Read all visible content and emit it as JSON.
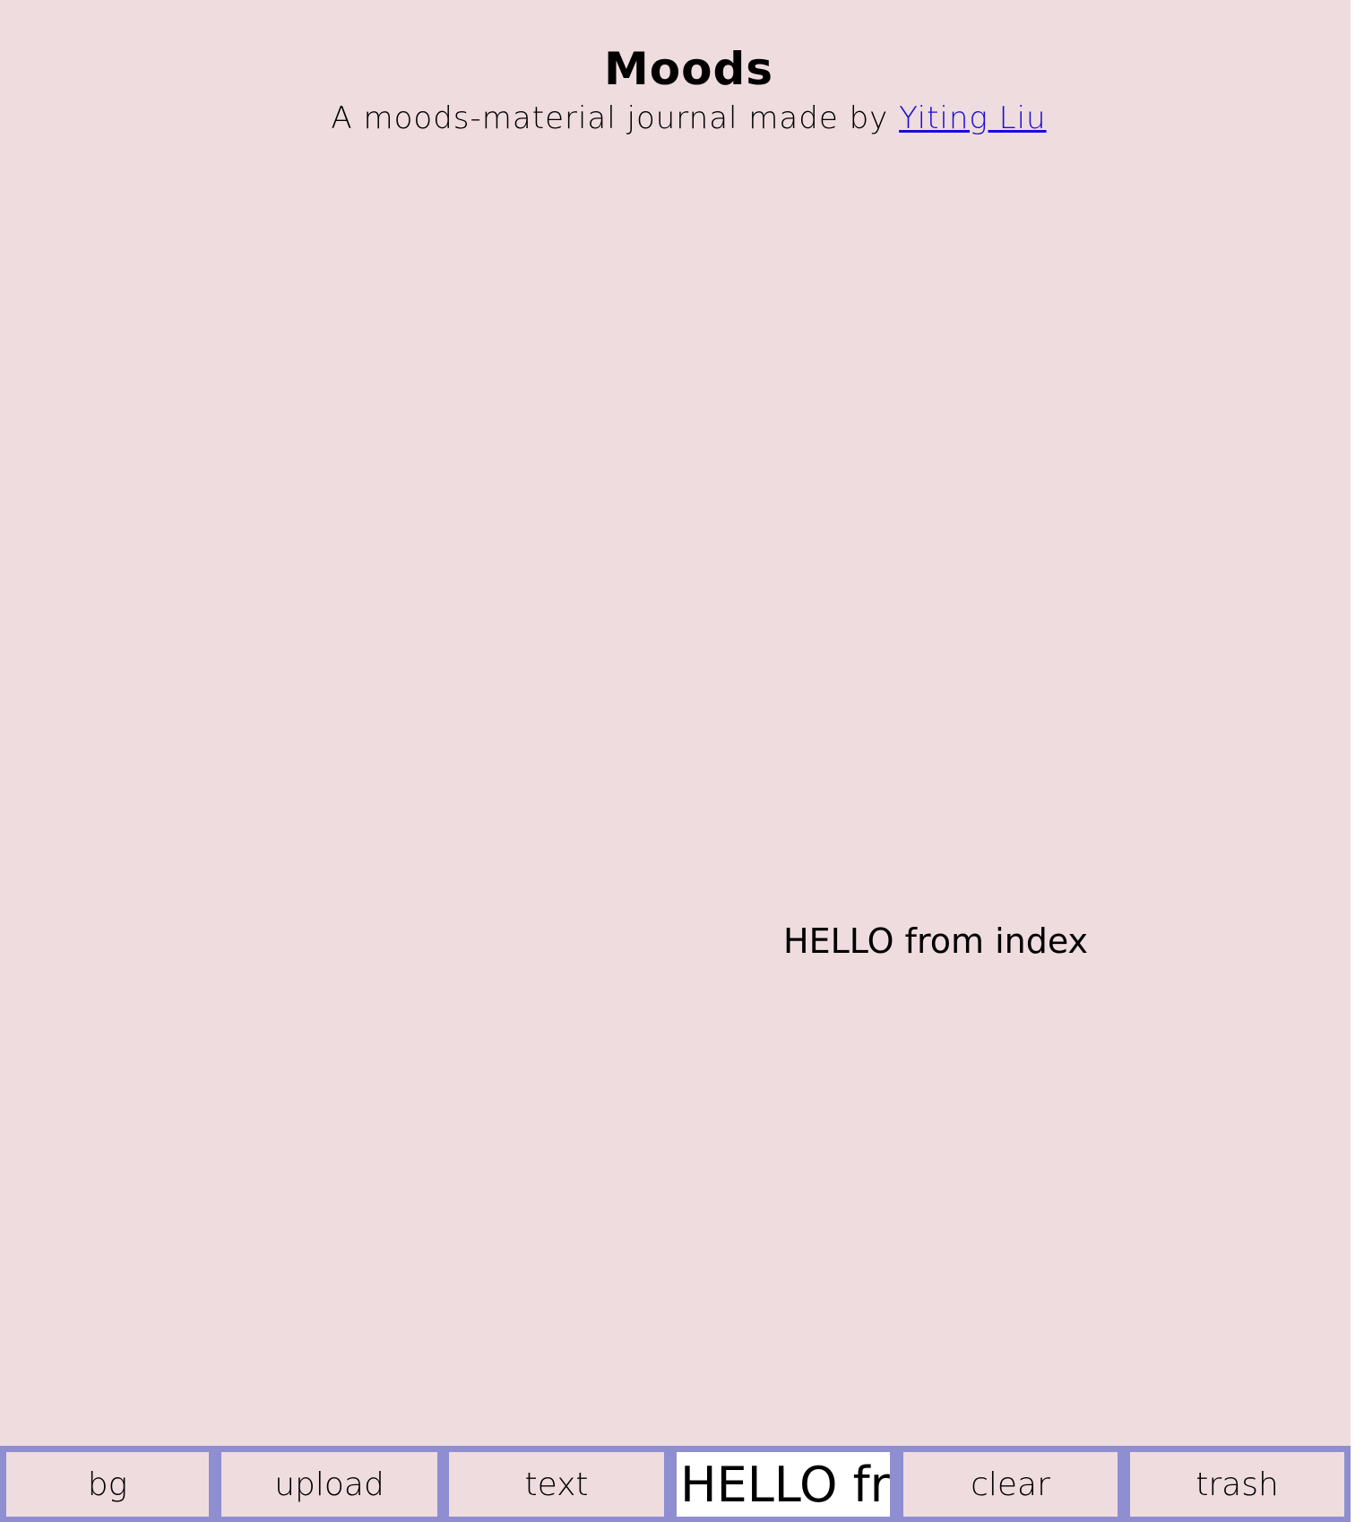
{
  "header": {
    "title": "Moods",
    "subtitle_prefix": "A moods-material journal made by ",
    "author_link": "Yiting Liu"
  },
  "canvas": {
    "sticker_text": "HELLO from index"
  },
  "toolbar": {
    "bg_label": "bg",
    "upload_label": "upload",
    "text_label": "text",
    "text_input_value": "HELLO from index",
    "clear_label": "clear",
    "trash_label": "trash"
  },
  "colors": {
    "canvas_bg": "#efdcdf",
    "toolbar_bg": "#8f8ed0",
    "link": "#1a0dd6"
  }
}
